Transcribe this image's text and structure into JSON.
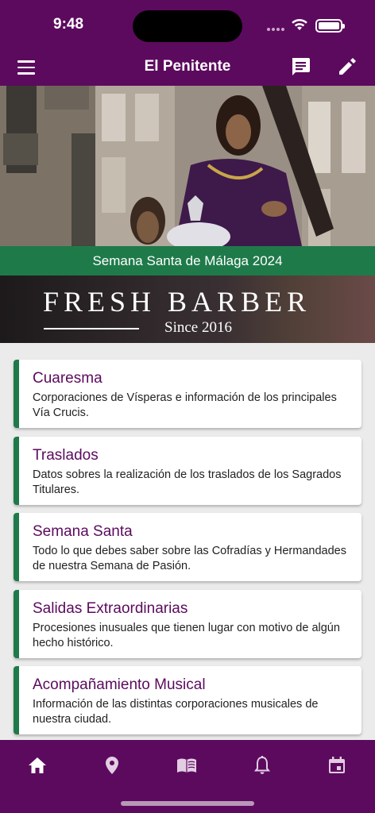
{
  "status": {
    "time": "9:48"
  },
  "app_bar": {
    "title": "El Penitente"
  },
  "hero": {
    "caption": "Semana Santa de Málaga 2024"
  },
  "ad": {
    "brand": "FRESH BARBER",
    "since": "Since 2016"
  },
  "cards": [
    {
      "title": "Cuaresma",
      "description": "Corporaciones de Vísperas e información de los principales Vía Crucis."
    },
    {
      "title": "Traslados",
      "description": "Datos sobres la realización de los traslados de los Sagrados Titulares."
    },
    {
      "title": "Semana Santa",
      "description": "Todo lo que debes saber sobre las Cofradías y Hermandades de nuestra Semana de Pasión."
    },
    {
      "title": "Salidas Extraordinarias",
      "description": "Procesiones inusuales que tienen lugar con motivo de algún hecho histórico."
    },
    {
      "title": "Acompañamiento Musical",
      "description": "Información de las distintas corporaciones musicales de nuestra ciudad."
    }
  ],
  "tabs": [
    {
      "icon": "home-icon",
      "active": true
    },
    {
      "icon": "location-pin-icon",
      "active": false
    },
    {
      "icon": "book-icon",
      "active": false
    },
    {
      "icon": "bell-icon",
      "active": false
    },
    {
      "icon": "calendar-icon",
      "active": false
    }
  ],
  "colors": {
    "primary": "#5c0a5e",
    "accent": "#1f7a4a",
    "background": "#ebebeb"
  }
}
